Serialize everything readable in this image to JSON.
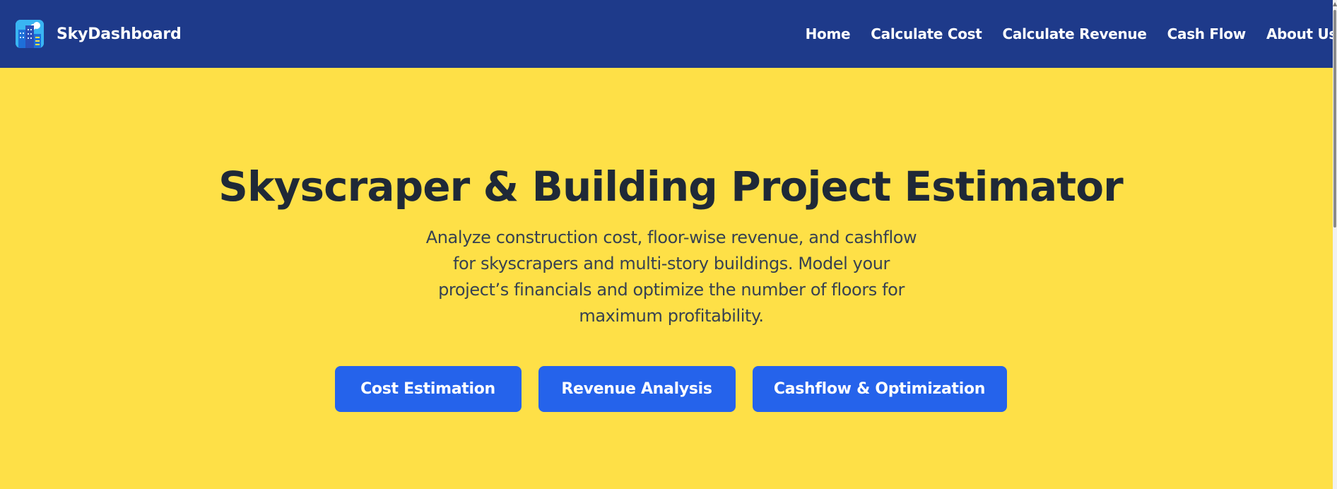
{
  "brand": {
    "name": "SkyDashboard",
    "logo_icon": "city-skyline-icon"
  },
  "nav": {
    "items": [
      {
        "label": "Home"
      },
      {
        "label": "Calculate Cost"
      },
      {
        "label": "Calculate Revenue"
      },
      {
        "label": "Cash Flow"
      },
      {
        "label": "About Us"
      }
    ]
  },
  "hero": {
    "title": "Skyscraper & Building Project Estimator",
    "description": "Analyze construction cost, floor-wise revenue, and cashflow for skyscrapers and multi-story buildings. Model your project’s financials and optimize the number of floors for maximum profitability.",
    "buttons": [
      {
        "label": "Cost Estimation"
      },
      {
        "label": "Revenue Analysis"
      },
      {
        "label": "Cashflow & Optimization"
      }
    ]
  },
  "colors": {
    "navbar_bg": "#1e3a8a",
    "hero_bg": "#fee047",
    "button_bg": "#2563eb",
    "title_text": "#1f2937"
  }
}
